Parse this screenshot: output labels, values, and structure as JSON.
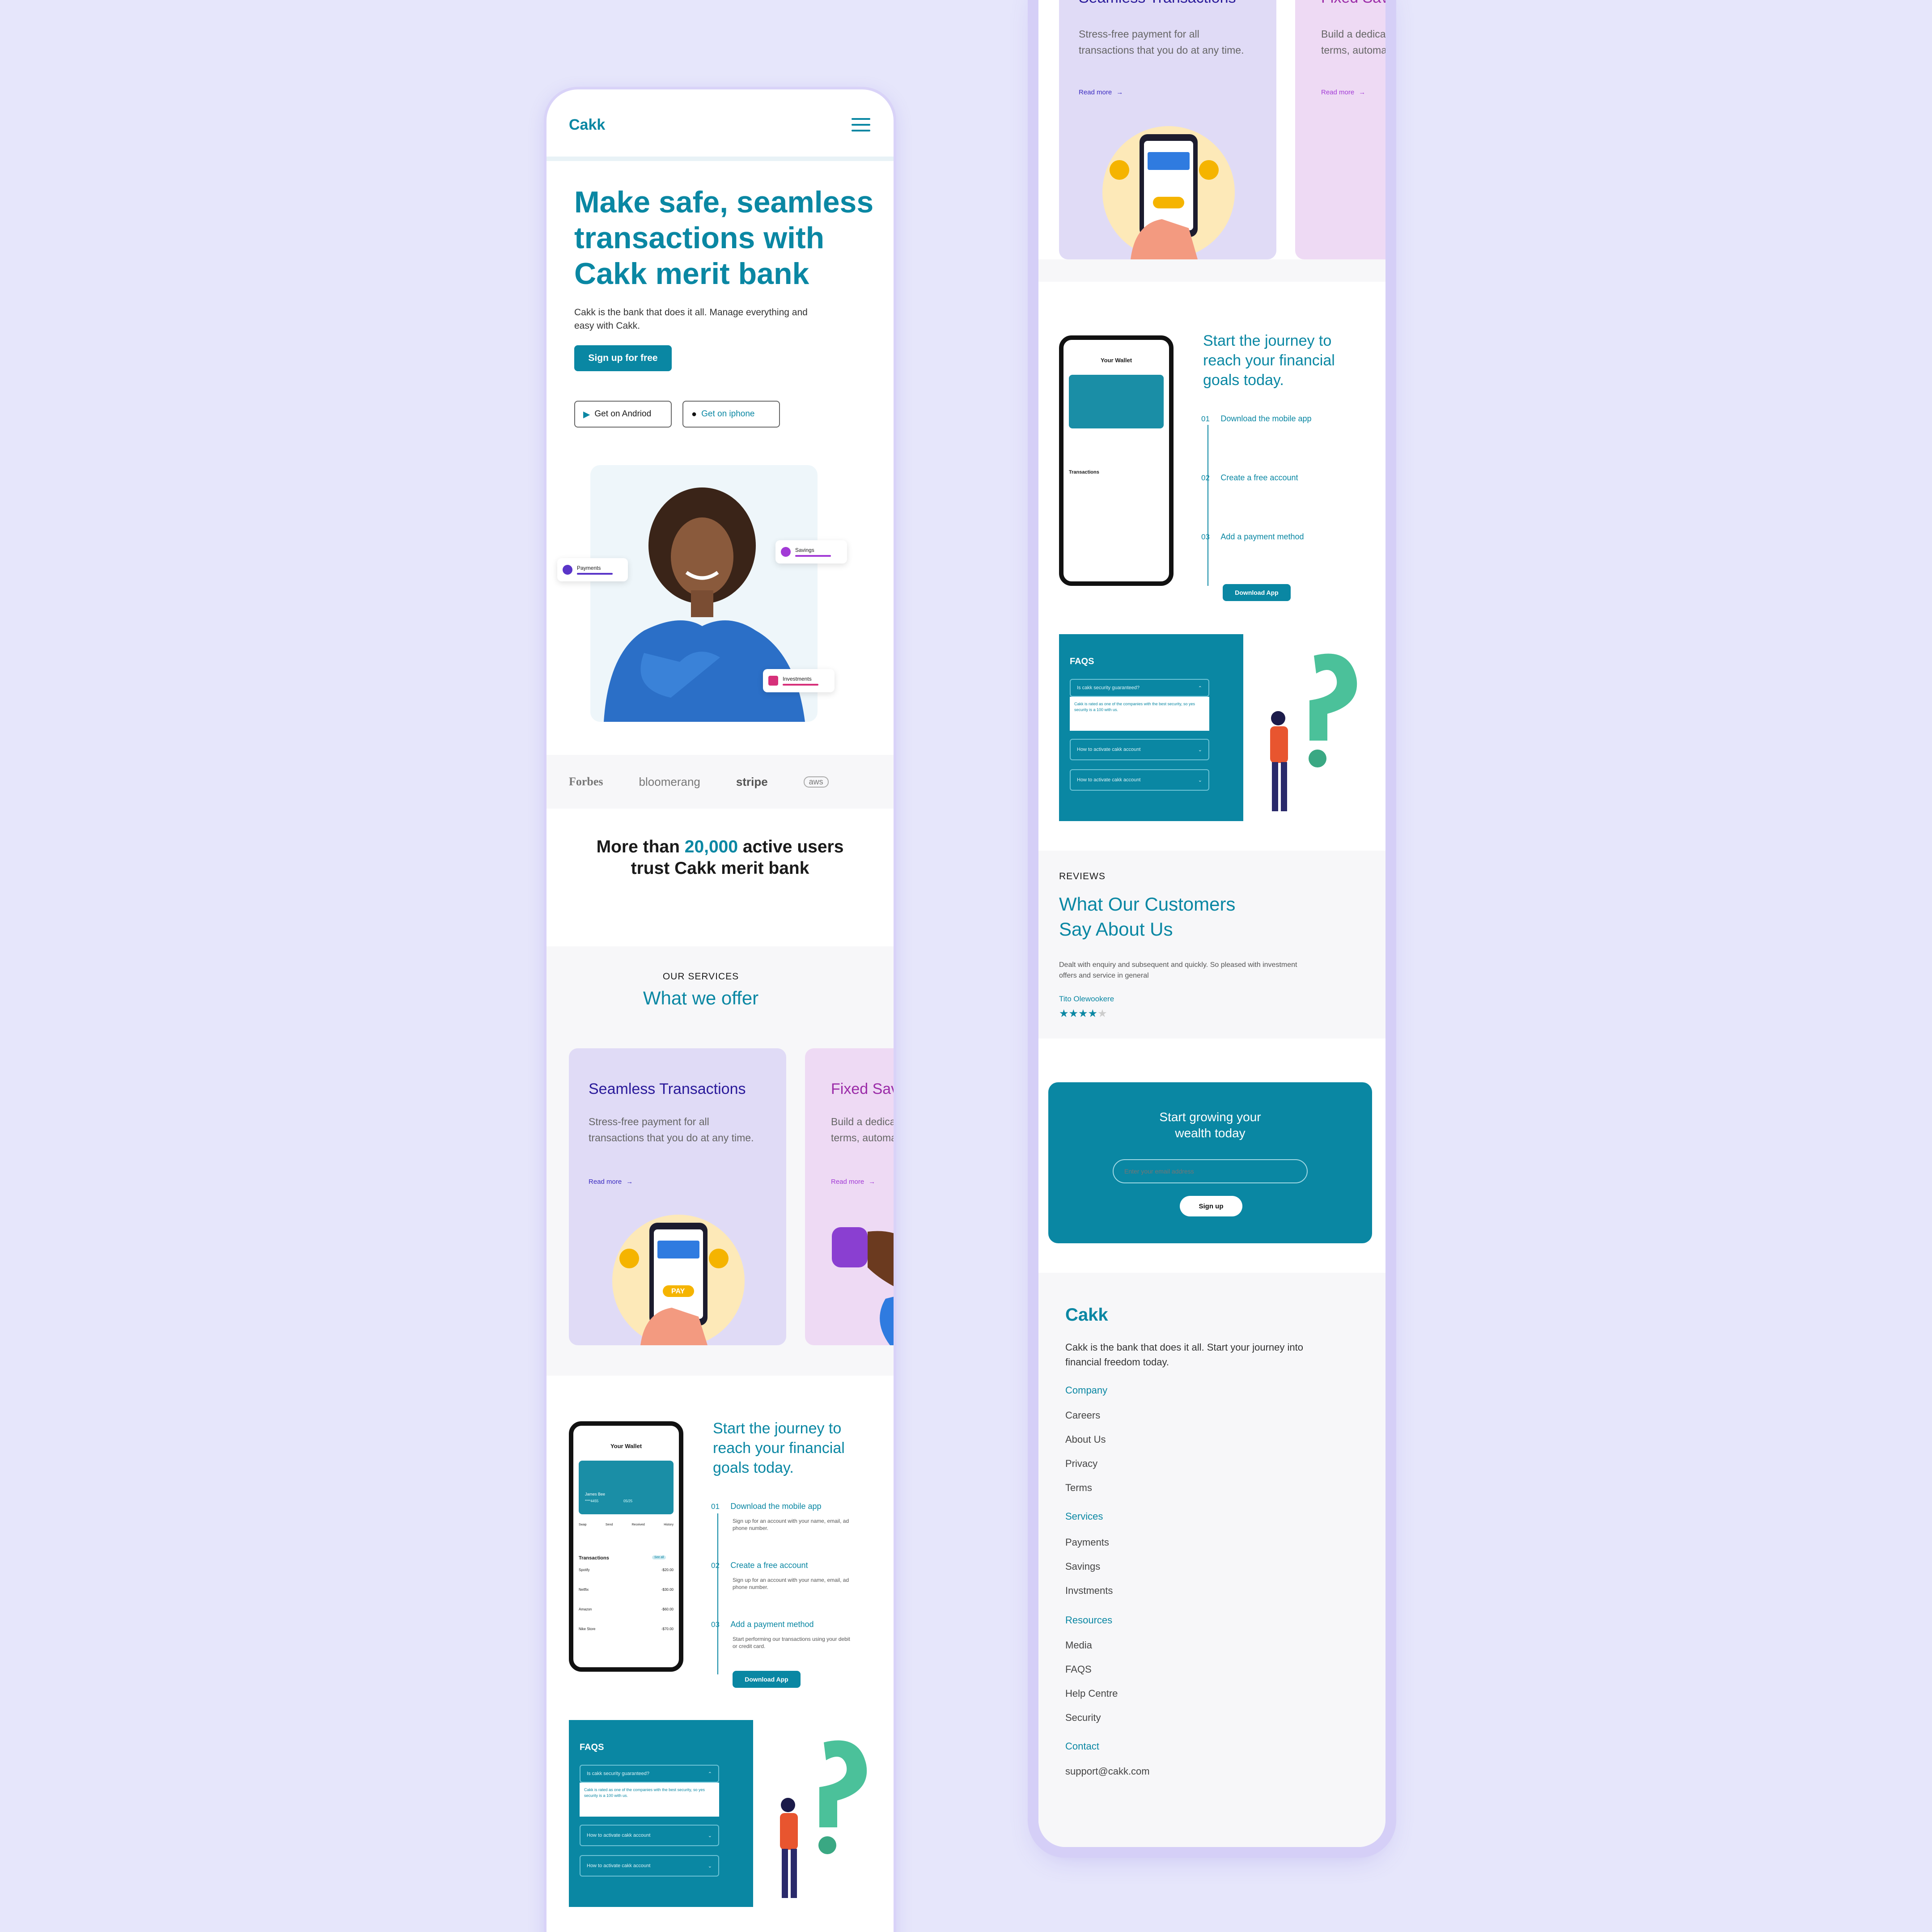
{
  "brand": {
    "name": "Cakk",
    "accent": "#0a87a3",
    "purple": "#7b2fd1",
    "background": "#e6e6fb"
  },
  "nav": {
    "logo": "Cakk",
    "menu_icon": "hamburger-icon"
  },
  "hero": {
    "title": "Make safe, seamless transactions with Cakk  merit bank",
    "subtitle": "Cakk is the bank that does it all. Manage everything and easy with Cakk.",
    "signup_label": "Sign up for free",
    "android_label": "Get on Andriod",
    "iphone_label": "Get on iphone",
    "chips": {
      "payments": "Payments",
      "savings": "Savings",
      "investments": "Investments"
    }
  },
  "partners": [
    "Forbes",
    "bloomerang",
    "stripe",
    "aws"
  ],
  "trust": {
    "prefix": "More than ",
    "count": "20,000",
    "suffix": " active users trust Cakk merit bank"
  },
  "services": {
    "eyebrow": "OUR SERVICES",
    "title": "What we offer",
    "cards": [
      {
        "title": "Seamless Transactions",
        "text": "Stress-free payment for all transactions that you do at any time.",
        "link": "Read more",
        "pay": "PAY"
      },
      {
        "title": "Fixed Savings",
        "text": "Build a dedicated savings on your terms, automatically or manually",
        "link": "Read more"
      }
    ]
  },
  "journey": {
    "title": "Start the journey to reach your financial goals today.",
    "steps": [
      {
        "num": "01",
        "head": "Download the mobile app",
        "text": "Sign up for an account with your name, email, ad phone number."
      },
      {
        "num": "02",
        "head": "Create a free account",
        "text": "Sign up for an account with your name, email, ad phone number."
      },
      {
        "num": "03",
        "head": "Add a payment method",
        "text": "Start performing our transactions using your debit or credit card."
      }
    ],
    "download_label": "Download App",
    "wallet": {
      "title": "Your Wallet",
      "card_name": "James Bee",
      "card_number": "****4455",
      "card_exp": "05/25",
      "actions": [
        "Swap",
        "Send",
        "Received",
        "History"
      ],
      "transactions_label": "Transactions",
      "see_all": "See all",
      "items": [
        {
          "name": "Spotify",
          "sub": "Subscription",
          "amount": "-$20.00"
        },
        {
          "name": "Netflix",
          "sub": "Subscription",
          "amount": "-$30.00"
        },
        {
          "name": "Amazon",
          "sub": "Shopping",
          "amount": "-$60.00"
        },
        {
          "name": "Nike Store",
          "sub": "Shoes",
          "amount": "-$70.00"
        }
      ],
      "tabs": [
        "Home",
        "Wallet",
        "Insights",
        "Profile"
      ]
    }
  },
  "faq": {
    "title": "FAQS",
    "items": [
      {
        "q": "Is cakk security guaranteed?",
        "a": "Cakk is rated as one of the companies with the best security, so yes security is a 100 with us."
      },
      {
        "q": "How to activate cakk account"
      },
      {
        "q": "How to activate cakk account"
      }
    ]
  },
  "reviews": {
    "eyebrow": "REVIEWS",
    "title": "What Our Customers Say About Us",
    "quote": "Dealt with enquiry and subsequent and quickly. So pleased with investment offers and service in general",
    "author": "Tito Olewookere",
    "rating": 4,
    "max_rating": 5
  },
  "cta": {
    "title": "Start growing your wealth today",
    "placeholder": "Enter your email address",
    "button": "Sign up"
  },
  "footer": {
    "logo": "Cakk",
    "tagline": "Cakk is the bank that does it all. Start your journey into financial freedom today.",
    "company": {
      "head": "Company",
      "links": [
        "Careers",
        "About Us",
        "Privacy",
        "Terms"
      ]
    },
    "services": {
      "head": "Services",
      "links": [
        "Payments",
        "Savings",
        "Invstments"
      ]
    },
    "resources": {
      "head": "Resources",
      "links": [
        "Media",
        "FAQS",
        "Help Centre",
        "Security"
      ]
    },
    "contact": {
      "head": "Contact",
      "email": "support@cakk.com"
    }
  }
}
